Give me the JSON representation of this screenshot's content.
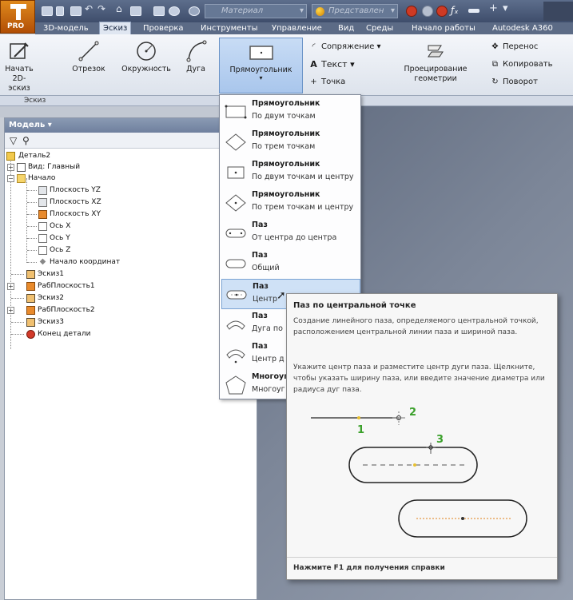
{
  "app": {
    "logo_text": "PRO",
    "material_placeholder": "Материал",
    "appearance_placeholder": "Представлен",
    "menu_tabs": [
      "3D-модель",
      "Эскиз",
      "Проверка",
      "Инструменты",
      "Управление",
      "Вид",
      "Среды",
      "Начало работы",
      "Autodesk A360"
    ],
    "active_tab": "Эскиз"
  },
  "ribbon": {
    "start_sketch": "Начать 2D-эскиз",
    "line": "Отрезок",
    "circle": "Окружность",
    "arc": "Дуга",
    "rectangle": "Прямоугольник",
    "fillet": "Сопряжение",
    "text": "Текст",
    "point": "Точка",
    "project": "Проецирование геометрии",
    "move": "Перенос",
    "copy": "Копировать",
    "rotate": "Поворот",
    "group_label": "Эскиз"
  },
  "browser": {
    "header": "Модель",
    "items": [
      {
        "label": "Деталь2"
      },
      {
        "label": "Вид: Главный"
      },
      {
        "label": "Начало"
      },
      {
        "label": "Плоскость YZ"
      },
      {
        "label": "Плоскость XZ"
      },
      {
        "label": "Плоскость XY"
      },
      {
        "label": "Ось X"
      },
      {
        "label": "Ось Y"
      },
      {
        "label": "Ось Z"
      },
      {
        "label": "Начало координат"
      },
      {
        "label": "Эскиз1"
      },
      {
        "label": "РабПлоскость1"
      },
      {
        "label": "Эскиз2"
      },
      {
        "label": "РабПлоскость2"
      },
      {
        "label": "Эскиз3"
      },
      {
        "label": "Конец детали"
      }
    ]
  },
  "dropdown": {
    "items": [
      {
        "title": "Прямоугольник",
        "subtitle": "По двум точкам"
      },
      {
        "title": "Прямоугольник",
        "subtitle": "По трем точкам"
      },
      {
        "title": "Прямоугольник",
        "subtitle": "По двум точкам и центру"
      },
      {
        "title": "Прямоугольник",
        "subtitle": "По трем точкам и центру"
      },
      {
        "title": "Паз",
        "subtitle": "От центра до центра"
      },
      {
        "title": "Паз",
        "subtitle": "Общий"
      },
      {
        "title": "Паз",
        "subtitle": "Центр"
      },
      {
        "title": "Паз",
        "subtitle": "Дуга по"
      },
      {
        "title": "Паз",
        "subtitle": "Центр д"
      },
      {
        "title": "Многоуг",
        "subtitle": "Многоуг"
      }
    ]
  },
  "tooltip": {
    "title": "Паз по центральной точке",
    "para1": "Создание линейного паза, определяемого центральной точкой, расположением центральной линии паза и шириной паза.",
    "para2": "Укажите центр паза и разместите центр дуги паза. Щелкните, чтобы указать ширину паза, или введите значение диаметра или радиуса дуг паза.",
    "step1": "1",
    "step2": "2",
    "step3": "3",
    "footer": "Нажмите F1 для получения справки"
  }
}
